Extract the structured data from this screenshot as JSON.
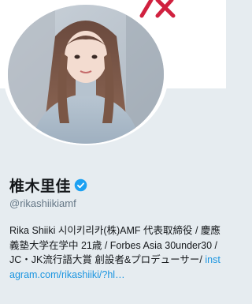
{
  "profile": {
    "display_name": "椎木里佳",
    "handle": "@rikashiikiamf",
    "bio_text": "Rika Shiiki 시이키리카(株)AMF 代表取締役 / 慶應義塾大学在学中 21歳 / Forbes Asia 30under30 / JC・JK流行語大賞 創設者&プロデューサー/ ",
    "bio_link": "instagram.com/rikashiiki/?hl…",
    "verified_icon": "verified-badge-icon"
  },
  "colors": {
    "background": "#e6ecf0",
    "link": "#1b95e0",
    "verified": "#1da1f2",
    "handle": "#657786",
    "banner_mark": "#e0245e"
  }
}
